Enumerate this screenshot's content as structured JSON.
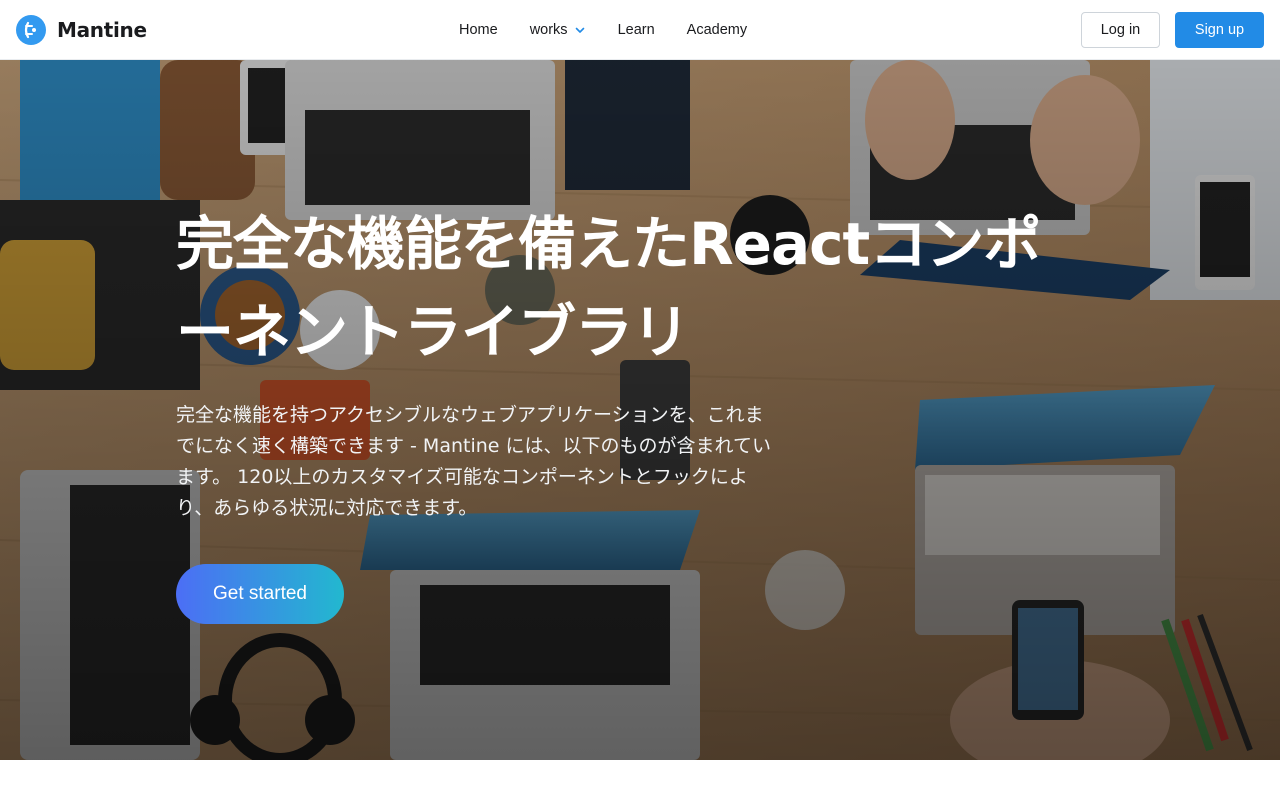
{
  "brand": {
    "name": "Mantine",
    "logo_icon": "mantine-logo-icon",
    "accent": "#339af0"
  },
  "nav": {
    "items": [
      {
        "label": "Home"
      },
      {
        "label": "works",
        "has_dropdown": true,
        "icon": "chevron-down-icon"
      },
      {
        "label": "Learn"
      },
      {
        "label": "Academy"
      }
    ]
  },
  "auth": {
    "login_label": "Log in",
    "signup_label": "Sign up",
    "signup_color": "#228be6"
  },
  "hero": {
    "title": "完全な機能を備えたReactコンポーネントライブラリ",
    "description": "完全な機能を持つアクセシブルなウェブアプリケーションを、これまでになく速く構築できます - Mantine には、以下のものが含まれています。 120以上のカスタマイズ可能なコンポーネントとフックにより、あらゆる状況に対応できます。",
    "cta_label": "Get started",
    "cta_gradient": [
      "#4c6ef5",
      "#22b8cf"
    ],
    "background": "photo of a wooden table with laptops, phones and people working"
  }
}
